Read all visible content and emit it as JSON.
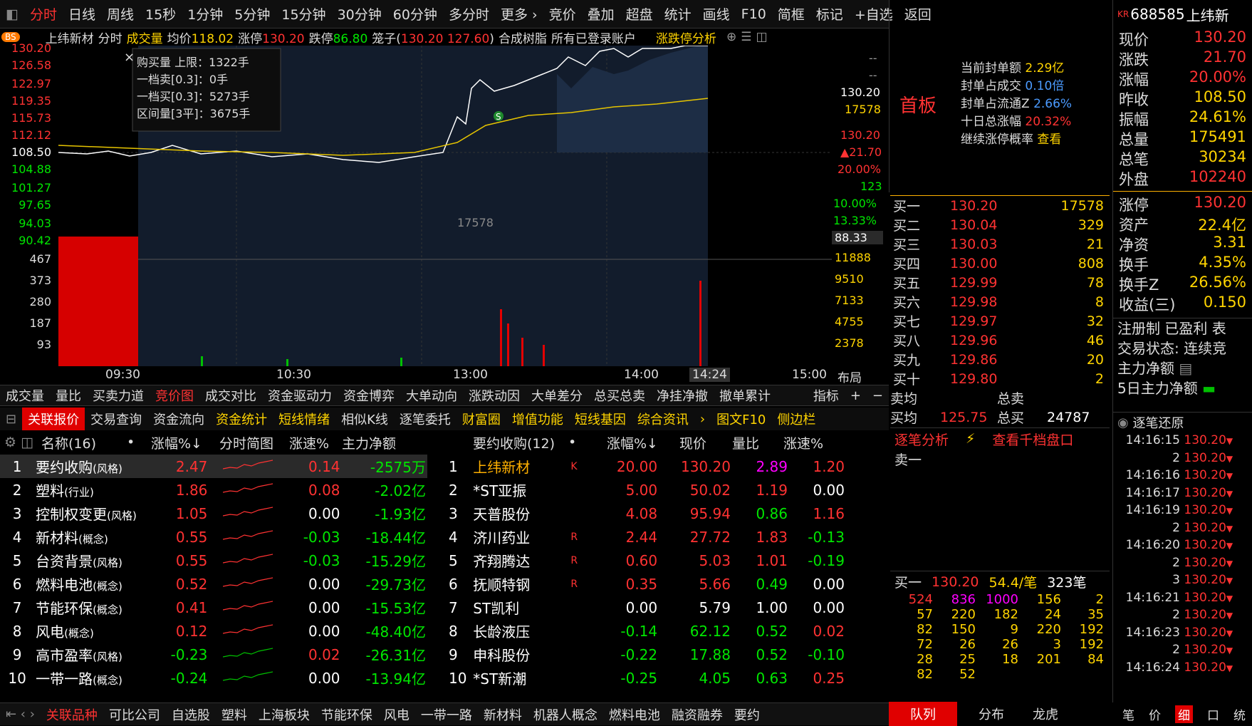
{
  "toolbar": {
    "items": [
      "分时",
      "日线",
      "周线",
      "15秒",
      "1分钟",
      "5分钟",
      "15分钟",
      "30分钟",
      "60分钟",
      "多分时",
      "更多 ›",
      "竞价",
      "叠加",
      "超盘",
      "统计",
      "画线",
      "F10",
      "简框",
      "标记",
      "+自选",
      "返回"
    ]
  },
  "chart_header": {
    "bs": "BS",
    "name": "上纬新材",
    "mode": "分时",
    "vol_label": "成交量",
    "avg_label": "均价",
    "avg": "118.02",
    "up_label": "涨停",
    "up": "130.20",
    "down_label": "跌停",
    "down": "86.80",
    "cage_label": "笼子(",
    "cage_hi": "130.20",
    "cage_lo": "127.60",
    "cage_close": ")",
    "resin": "合成树脂",
    "accounts": "所有已登录账户",
    "analysis": "涨跌停分析"
  },
  "tooltip": {
    "l1": "购买量 上限：1322手",
    "l2": "一档卖[0.3]：0手",
    "l3": "一档买[0.3]：5273手",
    "l4": "区间量[3平]：3675手",
    "close": "×"
  },
  "yaxis_left": [
    "130.20",
    "126.58",
    "122.97",
    "119.35",
    "115.73",
    "112.12",
    "108.50",
    "104.88",
    "101.27",
    "97.65",
    "94.03",
    "90.42"
  ],
  "yaxis_left_vol": [
    "467",
    "373",
    "280",
    "187",
    "93"
  ],
  "yaxis_right": {
    "dash1": "--",
    "dash2": "--",
    "price": "130.20",
    "vol": "17578",
    "p2": "130.20",
    "chg": "▲21.70",
    "pct": "20.00%",
    "n": "123",
    "pct2": "10.00%",
    "pct3": "13.33%",
    "p3": "88.33",
    "v1": "11888",
    "v2": "9510",
    "v3": "7133",
    "v4": "4755",
    "v5": "2378"
  },
  "xaxis": [
    "09:30",
    "10:30",
    "13:00",
    "14:00",
    "14:24",
    "15:00",
    "布局"
  ],
  "chart_vol_label": "17578",
  "chart_data": {
    "type": "line",
    "x": [
      "09:30",
      "10:30",
      "13:00",
      "14:00",
      "15:00"
    ],
    "ylim": [
      86.8,
      130.2
    ],
    "series": [
      {
        "name": "价格",
        "values": [
          108.5,
          107.8,
          106.5,
          130.2
        ]
      },
      {
        "name": "均价",
        "values": [
          108.5,
          108.0,
          107.0,
          118.02
        ]
      }
    ]
  },
  "indicator_tabs": [
    "成交量",
    "量比",
    "买卖力道",
    "竞价图",
    "成交对比",
    "资金驱动力",
    "资金博弈",
    "大单动向",
    "涨跌动因",
    "大单差分",
    "总买总卖",
    "净挂净撤",
    "撤单累计"
  ],
  "indicator_right": [
    "指标",
    "+",
    "−"
  ],
  "panel_tabs": [
    "关联报价",
    "交易查询",
    "资金流向",
    "资金统计",
    "短线情绪",
    "相似K线",
    "逐笔委托",
    "财富圈",
    "增值功能",
    "短线基因",
    "综合资讯",
    "›",
    "图文F10",
    "侧边栏"
  ],
  "left_table": {
    "headers": [
      "名称(16)",
      "•",
      "涨幅%↓",
      "分时简图",
      "涨速%",
      "主力净额"
    ],
    "rows": [
      {
        "n": "1",
        "name": "要约收购",
        "tag": "(风格)",
        "pct": "2.47",
        "spd": "0.14",
        "net": "-2575万"
      },
      {
        "n": "2",
        "name": "塑料",
        "tag": "(行业)",
        "pct": "1.86",
        "spd": "0.08",
        "net": "-2.02亿"
      },
      {
        "n": "3",
        "name": "控制权变更",
        "tag": "(风格)",
        "pct": "1.05",
        "spd": "0.00",
        "net": "-1.93亿"
      },
      {
        "n": "4",
        "name": "新材料",
        "tag": "(概念)",
        "pct": "0.55",
        "spd": "-0.03",
        "net": "-18.44亿"
      },
      {
        "n": "5",
        "name": "台资背景",
        "tag": "(风格)",
        "pct": "0.55",
        "spd": "-0.03",
        "net": "-15.29亿"
      },
      {
        "n": "6",
        "name": "燃料电池",
        "tag": "(概念)",
        "pct": "0.52",
        "spd": "0.00",
        "net": "-29.73亿"
      },
      {
        "n": "7",
        "name": "节能环保",
        "tag": "(概念)",
        "pct": "0.41",
        "spd": "0.00",
        "net": "-15.53亿"
      },
      {
        "n": "8",
        "name": "风电",
        "tag": "(概念)",
        "pct": "0.12",
        "spd": "0.00",
        "net": "-48.40亿"
      },
      {
        "n": "9",
        "name": "高市盈率",
        "tag": "(风格)",
        "pct": "-0.23",
        "spd": "0.02",
        "net": "-26.31亿"
      },
      {
        "n": "10",
        "name": "一带一路",
        "tag": "(概念)",
        "pct": "-0.24",
        "spd": "0.00",
        "net": "-13.94亿"
      }
    ]
  },
  "mid_table": {
    "headers": [
      "要约收购(12)",
      "•",
      "涨幅%↓",
      "现价",
      "量比",
      "涨速%"
    ],
    "rows": [
      {
        "n": "1",
        "name": "上纬新材",
        "flag": "K",
        "pct": "20.00",
        "price": "130.20",
        "vr": "2.89",
        "spd": "1.20"
      },
      {
        "n": "2",
        "name": "*ST亚振",
        "flag": "",
        "pct": "5.00",
        "price": "50.02",
        "vr": "1.19",
        "spd": "0.00"
      },
      {
        "n": "3",
        "name": "天普股份",
        "flag": "",
        "pct": "4.08",
        "price": "95.94",
        "vr": "0.86",
        "spd": "1.16"
      },
      {
        "n": "4",
        "name": "济川药业",
        "flag": "R",
        "pct": "2.44",
        "price": "27.72",
        "vr": "1.83",
        "spd": "-0.13"
      },
      {
        "n": "5",
        "name": "齐翔腾达",
        "flag": "R",
        "pct": "0.60",
        "price": "5.03",
        "vr": "1.01",
        "spd": "-0.19"
      },
      {
        "n": "6",
        "name": "抚顺特钢",
        "flag": "R",
        "pct": "0.35",
        "price": "5.66",
        "vr": "0.49",
        "spd": "0.00"
      },
      {
        "n": "7",
        "name": "ST凯利",
        "flag": "",
        "pct": "0.00",
        "price": "5.79",
        "vr": "1.00",
        "spd": "0.00"
      },
      {
        "n": "8",
        "name": "长龄液压",
        "flag": "",
        "pct": "-0.14",
        "price": "62.12",
        "vr": "0.52",
        "spd": "0.02"
      },
      {
        "n": "9",
        "name": "申科股份",
        "flag": "",
        "pct": "-0.22",
        "price": "17.88",
        "vr": "0.52",
        "spd": "-0.10"
      },
      {
        "n": "10",
        "name": "*ST新潮",
        "flag": "",
        "pct": "-0.25",
        "price": "4.05",
        "vr": "0.63",
        "spd": "0.25"
      }
    ]
  },
  "bottom_tabs": [
    "关联品种",
    "可比公司",
    "自选股",
    "塑料",
    "上海板块",
    "节能环保",
    "风电",
    "一带一路",
    "新材料",
    "机器人概念",
    "燃料电池",
    "融资融券",
    "要约"
  ],
  "seal": {
    "first": "首板",
    "l1k": "当前封单额",
    "l1v": "2.29亿",
    "l2k": "封单占成交",
    "l2v": "0.10倍",
    "l3k": "封单占流通Z",
    "l3v": "2.66%",
    "l4k": "十日总涨幅",
    "l4v": "20.32%",
    "l5k": "继续涨停概率",
    "l5v": "查看"
  },
  "orderbook": [
    {
      "l": "买一",
      "p": "130.20",
      "v": "17578"
    },
    {
      "l": "买二",
      "p": "130.04",
      "v": "329"
    },
    {
      "l": "买三",
      "p": "130.03",
      "v": "21"
    },
    {
      "l": "买四",
      "p": "130.00",
      "v": "808"
    },
    {
      "l": "买五",
      "p": "129.99",
      "v": "78"
    },
    {
      "l": "买六",
      "p": "129.98",
      "v": "8"
    },
    {
      "l": "买七",
      "p": "129.97",
      "v": "32"
    },
    {
      "l": "买八",
      "p": "129.96",
      "v": "46"
    },
    {
      "l": "买九",
      "p": "129.86",
      "v": "20"
    },
    {
      "l": "买十",
      "p": "129.80",
      "v": "2"
    }
  ],
  "avg": {
    "sell_avg": "卖均",
    "total_sell": "总卖",
    "buy_avg": "买均",
    "buy_avg_v": "125.75",
    "total_buy": "总买",
    "total_buy_v": "24787"
  },
  "tick_analysis": {
    "t1": "逐笔分析",
    "t2": "查看千档盘口",
    "sell1": "卖一",
    "buy1": "买一",
    "buy1p": "130.20",
    "per": "54.4/笔",
    "count": "323笔"
  },
  "queue": [
    [
      "524",
      "836",
      "1000",
      "156",
      "2"
    ],
    [
      "57",
      "220",
      "182",
      "24",
      "35"
    ],
    [
      "82",
      "150",
      "9",
      "220",
      "192"
    ],
    [
      "72",
      "26",
      "26",
      "3",
      "192"
    ],
    [
      "28",
      "25",
      "18",
      "201",
      "84"
    ],
    [
      "82",
      "52",
      "",
      "",
      ""
    ]
  ],
  "queue_tabs": [
    "队列",
    "分布",
    "龙虎"
  ],
  "quote": {
    "code": "688585",
    "name": "上纬新",
    "kr": "KR",
    "rows": [
      [
        "现价",
        "130.20"
      ],
      [
        "涨跌",
        "21.70"
      ],
      [
        "涨幅",
        "20.00%"
      ],
      [
        "昨收",
        "108.50"
      ],
      [
        "振幅",
        "24.61%"
      ],
      [
        "总量",
        "175491"
      ],
      [
        "总笔",
        "30234"
      ],
      [
        "外盘",
        "102240"
      ]
    ],
    "rows2": [
      [
        "涨停",
        "130.20"
      ],
      [
        "资产",
        "22.4亿"
      ],
      [
        "净资",
        "3.31"
      ],
      [
        "换手",
        "4.35%"
      ],
      [
        "换手Z",
        "26.56%"
      ],
      [
        "收益(三)",
        "0.150"
      ]
    ],
    "reg": "注册制 已盈利 表",
    "status": "交易状态: 连续竞",
    "main_net": "主力净额",
    "main5": "5日主力净额"
  },
  "ticks": {
    "title": "逐笔还原",
    "rows": [
      [
        "14:16:15",
        "130.20"
      ],
      [
        "2",
        "130.20"
      ],
      [
        "14:16:16",
        "130.20"
      ],
      [
        "14:16:17",
        "130.20"
      ],
      [
        "14:16:19",
        "130.20"
      ],
      [
        "2",
        "130.20"
      ],
      [
        "14:16:20",
        "130.20"
      ],
      [
        "2",
        "130.20"
      ],
      [
        "3",
        "130.20"
      ],
      [
        "14:16:21",
        "130.20"
      ],
      [
        "2",
        "130.20"
      ],
      [
        "14:16:23",
        "130.20"
      ],
      [
        "2",
        "130.20"
      ],
      [
        "14:16:24",
        "130.20"
      ]
    ]
  },
  "tick_tabs": [
    "笔",
    "价",
    "细",
    "口",
    "统"
  ]
}
